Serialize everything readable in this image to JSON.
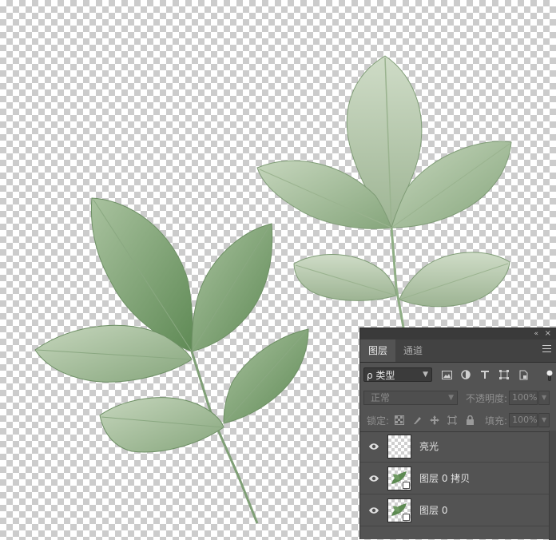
{
  "canvas": {
    "background": "transparent-checkerboard",
    "subject": "green-leaf-sprigs"
  },
  "panel": {
    "collapse_icon": "«",
    "close_icon": "×",
    "tabs": [
      {
        "label": "图层",
        "active": true
      },
      {
        "label": "通道",
        "active": false
      }
    ],
    "filter": {
      "kind_label": "ρ 类型",
      "icons": [
        "image-filter-icon",
        "adjustment-filter-icon",
        "type-filter-icon",
        "shape-filter-icon",
        "smart-object-filter-icon"
      ]
    },
    "blend": {
      "mode": "正常",
      "opacity_label": "不透明度:",
      "opacity_value": "100%"
    },
    "lock": {
      "label": "锁定:",
      "icons": [
        "lock-transparent-pixels-icon",
        "lock-image-pixels-icon",
        "lock-position-icon",
        "lock-artboard-icon",
        "lock-all-icon"
      ],
      "fill_label": "填充:",
      "fill_value": "100%"
    },
    "layers": [
      {
        "name": "亮光",
        "visible": true,
        "thumb": "empty"
      },
      {
        "name": "图层 0 拷贝",
        "visible": true,
        "thumb": "leaf"
      },
      {
        "name": "图层 0",
        "visible": true,
        "thumb": "leaf"
      }
    ]
  },
  "colors": {
    "panel_bg": "#535353",
    "tab_bar": "#424242",
    "leaf_light": "#b8cdb0",
    "leaf_dark": "#6f9465"
  }
}
